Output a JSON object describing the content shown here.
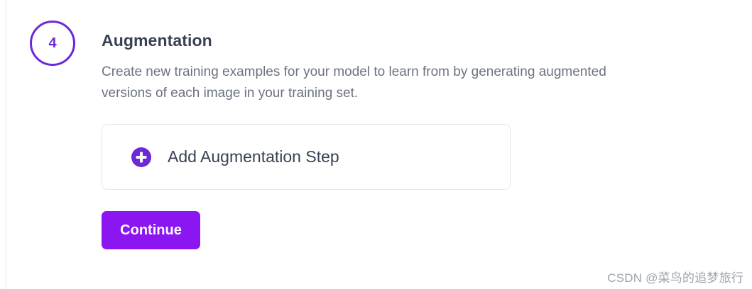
{
  "step": {
    "number": "4",
    "title": "Augmentation",
    "description": "Create new training examples for your model to learn from by generating augmented versions of each image in your training set."
  },
  "add_step": {
    "label": "Add Augmentation Step",
    "icon": "plus-circle-icon"
  },
  "actions": {
    "continue_label": "Continue"
  },
  "watermark": {
    "text": "CSDN @菜鸟的追梦旅行"
  },
  "colors": {
    "accent": "#6d28d9",
    "button": "#8b16f2",
    "title": "#374151",
    "description": "#6b7280",
    "border": "#e5e7eb"
  }
}
